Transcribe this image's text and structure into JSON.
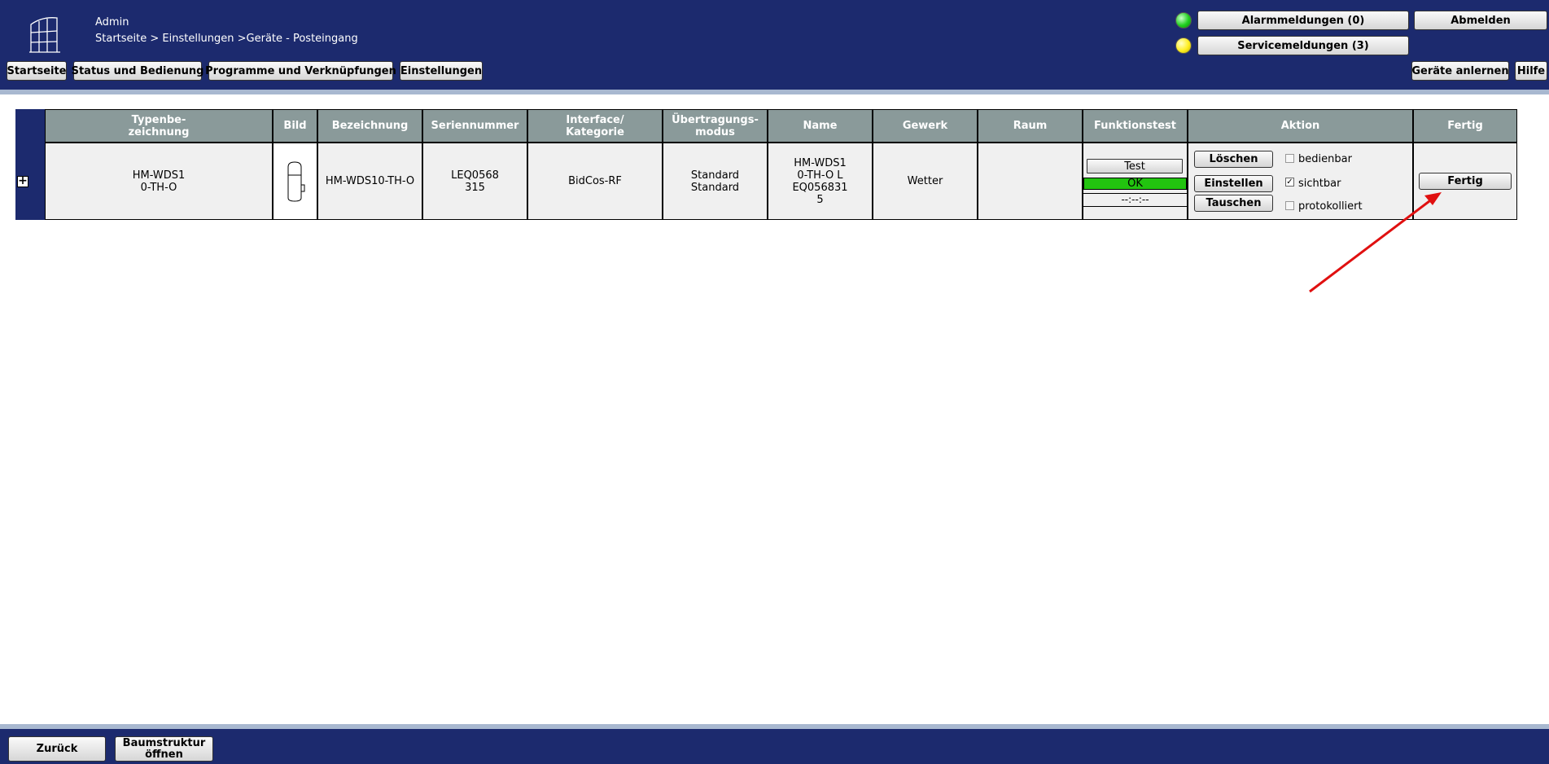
{
  "header": {
    "user": "Admin",
    "breadcrumb": "Startseite > Einstellungen >Geräte - Posteingang",
    "nav": {
      "home": "Startseite",
      "status": "Status und Bedienung",
      "programs": "Programme und Verknüpfungen",
      "settings": "Einstellungen"
    },
    "alarm_button": "Alarmmeldungen (0)",
    "service_button": "Servicemeldungen (3)",
    "logout_button": "Abmelden",
    "teach_button": "Geräte anlernen",
    "help_button": "Hilfe",
    "colors": {
      "bar": "#1c2a6e",
      "alarm_led": "#1fcf1f",
      "service_led": "#ffee20"
    }
  },
  "table": {
    "expand_symbol": "+",
    "columns": {
      "type": "Typenbe-\nzeichnung",
      "image": "Bild",
      "designation": "Bezeichnung",
      "serial": "Seriennummer",
      "interface": "Interface/\nKategorie",
      "transfer": "Übertragungs-\nmodus",
      "name": "Name",
      "trade": "Gewerk",
      "room": "Raum",
      "test": "Funktionstest",
      "action": "Aktion",
      "done": "Fertig"
    },
    "row": {
      "type": "HM-WDS1\n0-TH-O",
      "designation": "HM-WDS10-TH-O",
      "serial": "LEQ0568\n315",
      "interface": "BidCos-RF",
      "transfer": "Standard\nStandard",
      "name": "HM-WDS1\n0-TH-O L\nEQ056831\n5",
      "trade": "Wetter",
      "room": "",
      "test_button": "Test",
      "test_result": "OK",
      "test_time": "--:--:--",
      "delete_button": "Löschen",
      "configure_button": "Einstellen",
      "swap_button": "Tauschen",
      "operable_label": "bedienbar",
      "visible_label": "sichtbar",
      "logged_label": "protokolliert",
      "operable_checked": false,
      "visible_checked": true,
      "logged_checked": false,
      "done_button": "Fertig"
    }
  },
  "footer": {
    "back_button": "Zurück",
    "tree_button": "Baumstruktur\nöffnen"
  }
}
